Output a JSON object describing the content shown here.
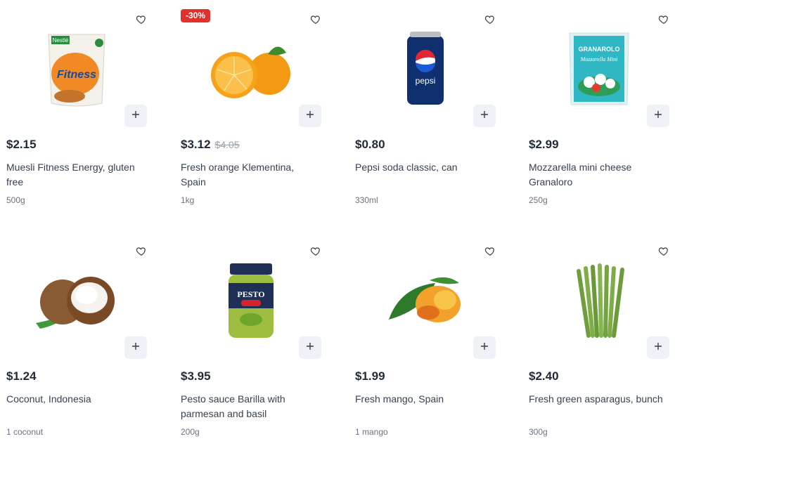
{
  "products": [
    {
      "price": "$2.15",
      "old_price": "",
      "badge": "",
      "title": "Muesli Fitness Energy, gluten free",
      "weight": "500g",
      "image": "muesli-fitness-package"
    },
    {
      "price": "$3.12",
      "old_price": "$4.05",
      "badge": "-30%",
      "title": "Fresh orange Klementina, Spain",
      "weight": "1kg",
      "image": "orange-fruit"
    },
    {
      "price": "$0.80",
      "old_price": "",
      "badge": "",
      "title": "Pepsi soda classic, can",
      "weight": "330ml",
      "image": "pepsi-can"
    },
    {
      "price": "$2.99",
      "old_price": "",
      "badge": "",
      "title": "Mozzarella mini cheese Granaloro",
      "weight": "250g",
      "image": "mozzarella-bag"
    },
    {
      "price": "$1.24",
      "old_price": "",
      "badge": "",
      "title": "Coconut, Indonesia",
      "weight": "1 coconut",
      "image": "coconut"
    },
    {
      "price": "$3.95",
      "old_price": "",
      "badge": "",
      "title": "Pesto sauce Barilla with parmesan and basil",
      "weight": "200g",
      "image": "pesto-jar"
    },
    {
      "price": "$1.99",
      "old_price": "",
      "badge": "",
      "title": "Fresh mango, Spain",
      "weight": "1 mango",
      "image": "mango"
    },
    {
      "price": "$2.40",
      "old_price": "",
      "badge": "",
      "title": "Fresh green asparagus, bunch",
      "weight": "300g",
      "image": "asparagus-bunch"
    }
  ],
  "icons": {
    "favorite": "heart-outline-icon",
    "add": "plus-icon"
  },
  "colors": {
    "badge": "#e0312b",
    "add_button_bg": "#eef1f5",
    "old_price": "#9aa0a8"
  }
}
